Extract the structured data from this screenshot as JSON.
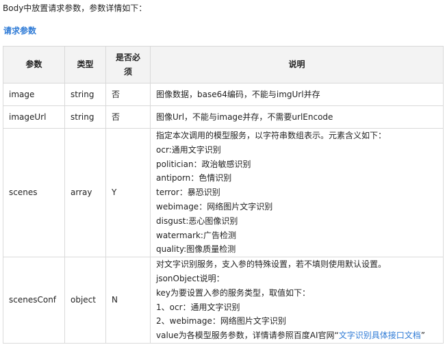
{
  "intro_text": "Body中放置请求参数，参数详情如下：",
  "section_heading": "请求参数",
  "table": {
    "headers": [
      "参数",
      "类型",
      "是否必须",
      "说明"
    ],
    "rows": [
      {
        "param": "image",
        "type": "string",
        "required": "否",
        "description": [
          "图像数据，base64编码，不能与imgUrl并存"
        ]
      },
      {
        "param": "imageUrl",
        "type": "string",
        "required": "否",
        "description": [
          "图像Url，不能与image并存，不需要urlEncode"
        ]
      },
      {
        "param": "scenes",
        "type": "array",
        "required": "Y",
        "description": [
          "指定本次调用的模型服务，以字符串数组表示。元素含义如下：",
          "ocr:通用文字识别",
          "politician：政治敏感识别",
          "antiporn：色情识别",
          "terror：暴恐识别",
          "webimage：网络图片文字识别",
          "disgust:恶心图像识别",
          "watermark:广告检测",
          "quality:图像质量检测"
        ]
      },
      {
        "param": "scenesConf",
        "type": "object",
        "required": "N",
        "description": [
          "对文字识别服务，支入参的特殊设置，若不填则使用默认设置。",
          "jsonObject说明：",
          "key为要设置入参的服务类型，取值如下：",
          "1、ocr：通用文字识别",
          "2、webimage：网络图片文字识别"
        ],
        "description_last_prefix": "value为各模型服务参数，详情请参照百度AI官网“",
        "description_last_link": "文字识别具体接口文档",
        "description_last_suffix": "”"
      }
    ]
  }
}
